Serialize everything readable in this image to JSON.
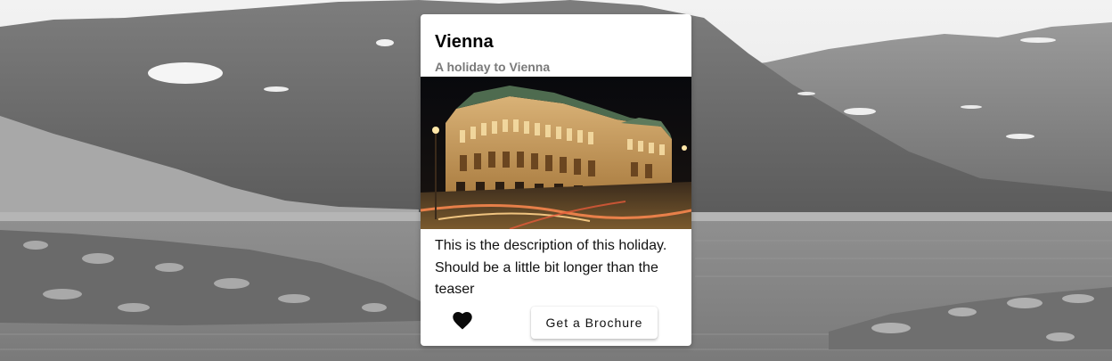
{
  "background": {
    "description_icon": "mountain-lake-landscape"
  },
  "card": {
    "title": "Vienna",
    "subtitle": "A holiday to Vienna",
    "photo_icon": "opera-house-photo",
    "description": "This is the description of this holiday. Should be a little bit longer than the teaser",
    "favorite_icon": "heart-icon",
    "brochure_label": "Get a Brochure"
  }
}
